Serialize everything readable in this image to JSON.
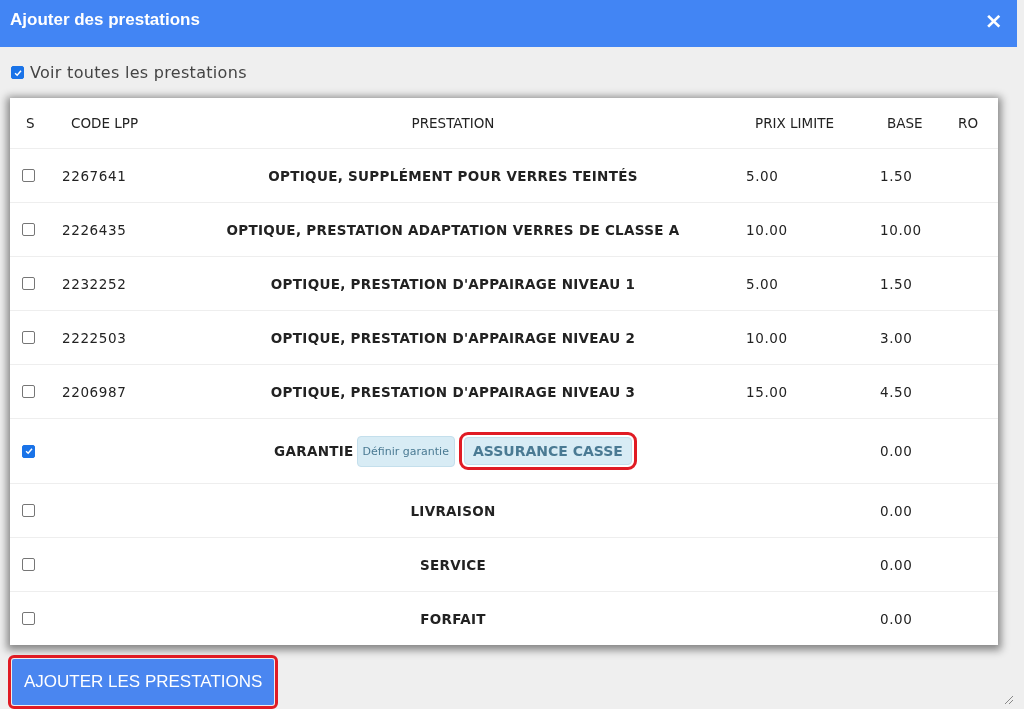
{
  "dialog": {
    "title": "Ajouter des prestations",
    "close": "×"
  },
  "show_all": {
    "label": "Voir toutes les prestations",
    "checked": true
  },
  "table": {
    "columns": [
      "S",
      "CODE LPP",
      "PRESTATION",
      "PRIX LIMITE",
      "BASE",
      "RO"
    ],
    "rows": [
      {
        "checked": false,
        "code": "2267641",
        "prestation": "OPTIQUE, SUPPLÉMENT POUR VERRES TEINTÉS",
        "prix_limite": "5.00",
        "base": "1.50"
      },
      {
        "checked": false,
        "code": "2226435",
        "prestation": "OPTIQUE, PRESTATION ADAPTATION VERRES DE CLASSE A",
        "prix_limite": "10.00",
        "base": "10.00"
      },
      {
        "checked": false,
        "code": "2232252",
        "prestation": "OPTIQUE, PRESTATION D'APPAIRAGE NIVEAU 1",
        "prix_limite": "5.00",
        "base": "1.50"
      },
      {
        "checked": false,
        "code": "2222503",
        "prestation": "OPTIQUE, PRESTATION D'APPAIRAGE NIVEAU 2",
        "prix_limite": "10.00",
        "base": "3.00"
      },
      {
        "checked": false,
        "code": "2206987",
        "prestation": "OPTIQUE, PRESTATION D'APPAIRAGE NIVEAU 3",
        "prix_limite": "15.00",
        "base": "4.50"
      },
      {
        "checked": true,
        "prestation": "GARANTIE",
        "buttons": [
          {
            "label": "Définir garantie",
            "highlighted": false
          },
          {
            "label": "ASSURANCE CASSE",
            "highlighted": true
          }
        ],
        "base": "0.00"
      },
      {
        "checked": false,
        "prestation": "LIVRAISON",
        "base": "0.00"
      },
      {
        "checked": false,
        "prestation": "SERVICE",
        "base": "0.00"
      },
      {
        "checked": false,
        "prestation": "FORFAIT",
        "base": "0.00"
      }
    ]
  },
  "submit": {
    "label": "AJOUTER LES PRESTATIONS",
    "highlighted": true
  }
}
